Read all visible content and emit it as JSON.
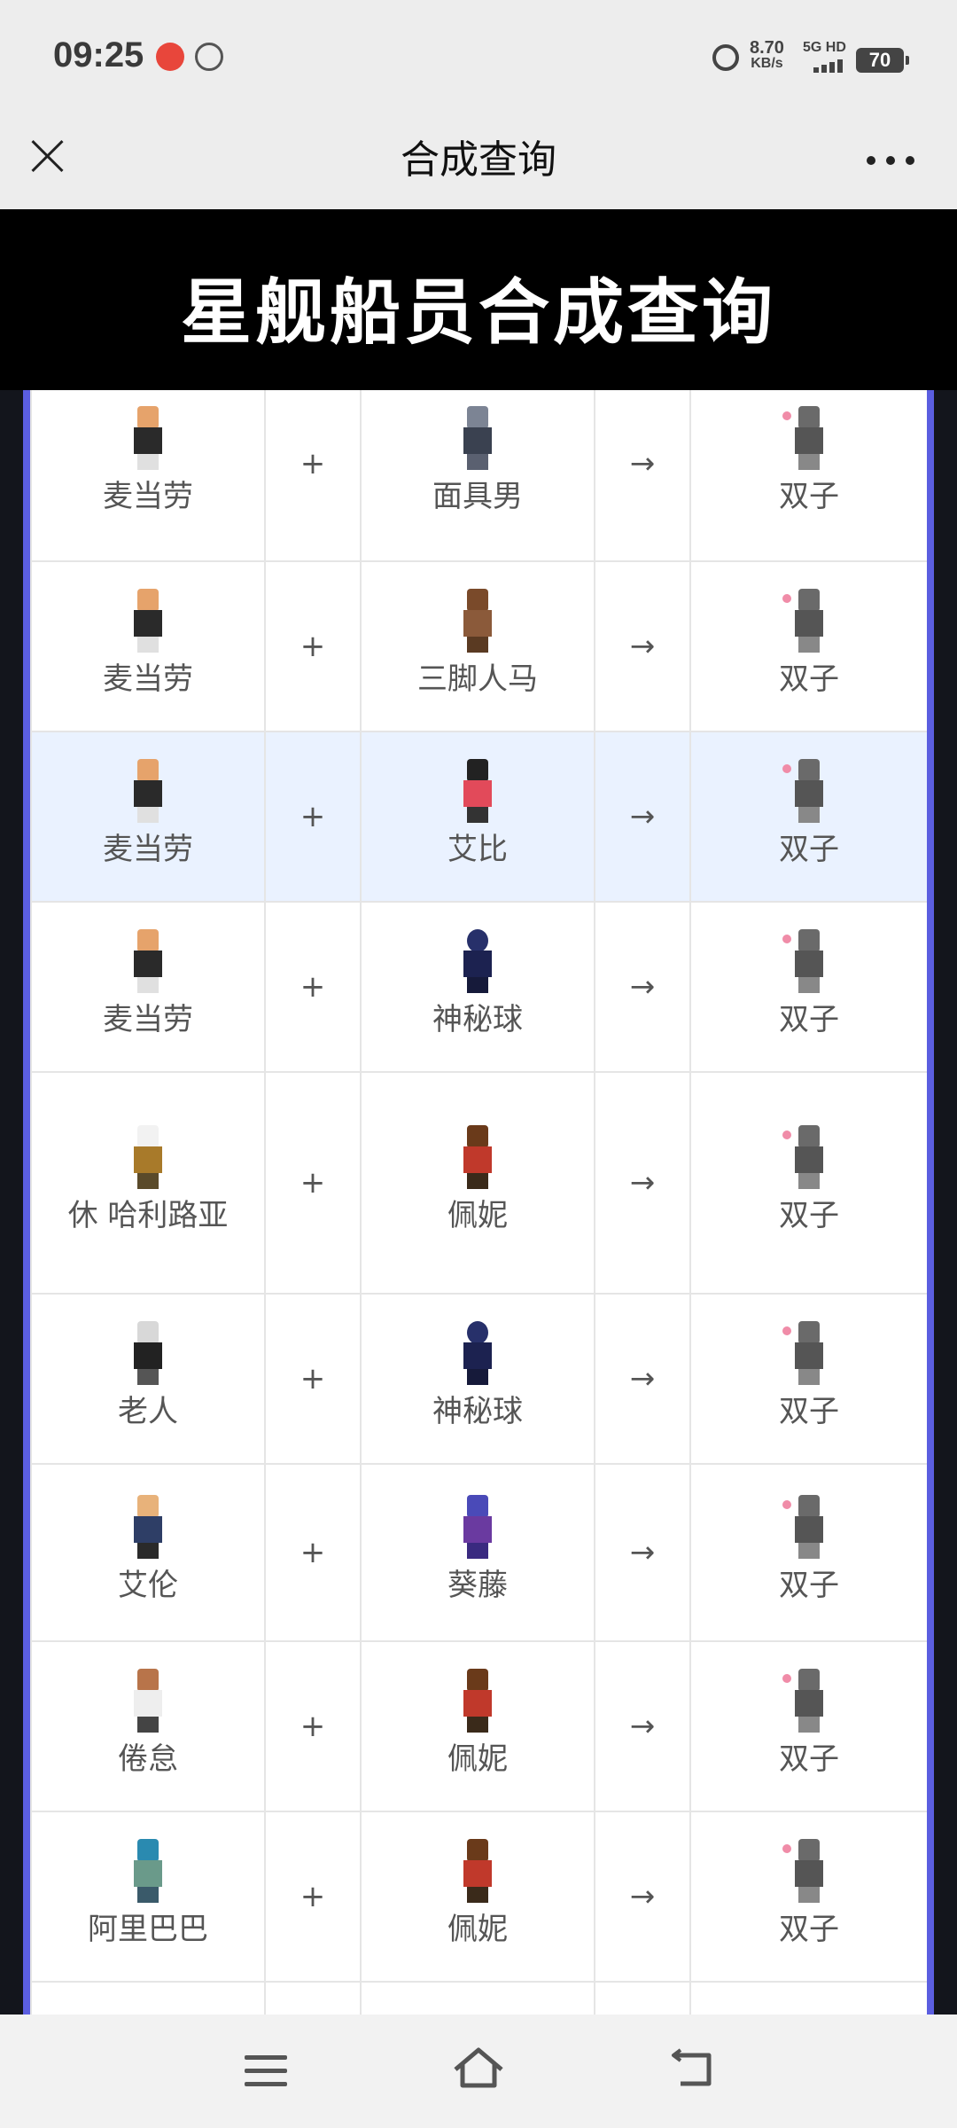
{
  "status_bar": {
    "time": "09:25",
    "net_speed_value": "8.70",
    "net_speed_unit": "KB/s",
    "signal_label": "5G HD",
    "battery": "70"
  },
  "nav": {
    "title": "合成查询"
  },
  "banner": {
    "title": "星舰船员合成查询"
  },
  "table": {
    "plus": "+",
    "arrow": "→",
    "rows": [
      {
        "a": "麦当劳",
        "a_icon": "mcdonald-sprite-icon",
        "b": "面具男",
        "b_icon": "mask-man-sprite-icon",
        "c": "双子",
        "c_icon": "twins-sprite-icon"
      },
      {
        "a": "麦当劳",
        "a_icon": "mcdonald-sprite-icon",
        "b": "三脚人马",
        "b_icon": "centaur-sprite-icon",
        "c": "双子",
        "c_icon": "twins-sprite-icon"
      },
      {
        "a": "麦当劳",
        "a_icon": "mcdonald-sprite-icon",
        "b": "艾比",
        "b_icon": "abby-sprite-icon",
        "c": "双子",
        "c_icon": "twins-sprite-icon",
        "highlighted": true
      },
      {
        "a": "麦当劳",
        "a_icon": "mcdonald-sprite-icon",
        "b": "神秘球",
        "b_icon": "mystery-orb-sprite-icon",
        "c": "双子",
        "c_icon": "twins-sprite-icon"
      },
      {
        "a": "休 哈利路亚",
        "a_icon": "captain-sprite-icon",
        "b": "佩妮",
        "b_icon": "penny-sprite-icon",
        "c": "双子",
        "c_icon": "twins-sprite-icon"
      },
      {
        "a": "老人",
        "a_icon": "old-man-sprite-icon",
        "b": "神秘球",
        "b_icon": "mystery-orb-sprite-icon",
        "c": "双子",
        "c_icon": "twins-sprite-icon"
      },
      {
        "a": "艾伦",
        "a_icon": "allen-sprite-icon",
        "b": "葵藤",
        "b_icon": "kuiteng-sprite-icon",
        "c": "双子",
        "c_icon": "twins-sprite-icon"
      },
      {
        "a": "倦怠",
        "a_icon": "weary-sprite-icon",
        "b": "佩妮",
        "b_icon": "penny-sprite-icon",
        "c": "双子",
        "c_icon": "twins-sprite-icon"
      },
      {
        "a": "阿里巴巴",
        "a_icon": "alibaba-sprite-icon",
        "b": "佩妮",
        "b_icon": "penny-sprite-icon",
        "c": "双子",
        "c_icon": "twins-sprite-icon"
      }
    ]
  }
}
